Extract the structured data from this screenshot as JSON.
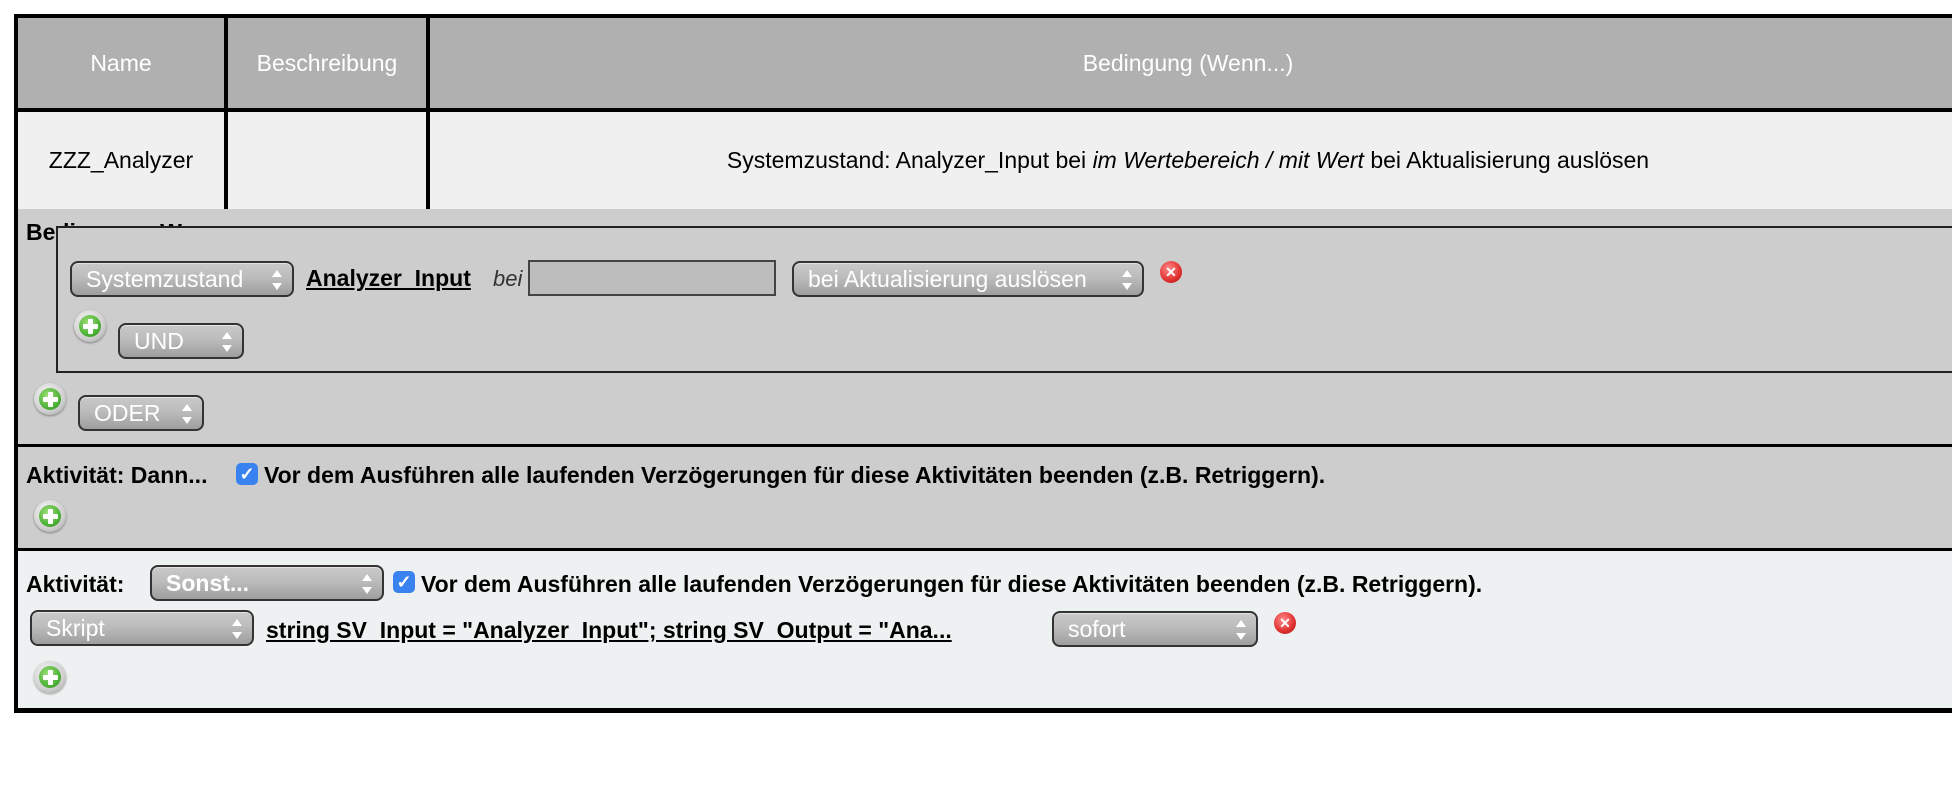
{
  "table": {
    "headers": [
      "Name",
      "Beschreibung",
      "Bedingung (Wenn...)"
    ],
    "row": {
      "name": "ZZZ_Analyzer",
      "description": "",
      "condition_prefix": "Systemzustand: Analyzer_Input bei ",
      "condition_italic": "im Wertebereich / mit Wert",
      "condition_suffix": " bei Aktualisierung auslösen"
    }
  },
  "condition_section": {
    "title": "Bedingung: Wenn...",
    "type_select": "Systemzustand",
    "device_link": "Analyzer_Input",
    "bei_label": "bei",
    "value_input": "",
    "trigger_select": "bei Aktualisierung auslösen",
    "and_select": "UND",
    "or_select": "ODER"
  },
  "then_section": {
    "title": "Aktivität: Dann...",
    "checkbox_label": "Vor dem Ausführen alle laufenden Verzögerungen für diese Aktivitäten beenden (z.B. Retriggern)."
  },
  "else_section": {
    "title": "Aktivität:",
    "mode_select": "Sonst...",
    "checkbox_label": "Vor dem Ausführen alle laufenden Verzögerungen für diese Aktivitäten beenden (z.B. Retriggern).",
    "action_type_select": "Skript",
    "script_link": "string SV_Input = \"Analyzer_Input\"; string SV_Output = \"Ana...",
    "timing_select": "sofort"
  },
  "colors": {
    "header_bg": "#b0b0b0",
    "section_bg": "#cdcdcd",
    "else_bg": "#eef1f1",
    "checkbox": "#3a82f0"
  }
}
